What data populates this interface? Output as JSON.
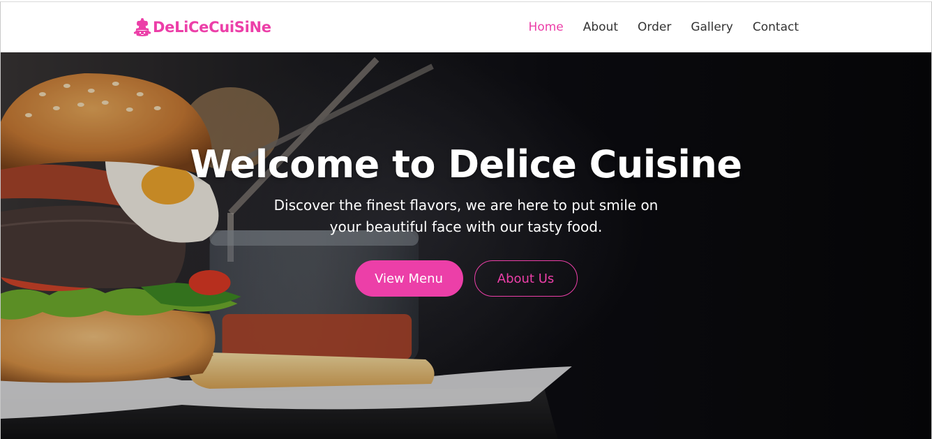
{
  "brand": {
    "name": "DeLiCeCuiSiNe",
    "icon": "chef-hat-logo-icon",
    "color": "#ec3fa8"
  },
  "nav": {
    "items": [
      {
        "label": "Home",
        "active": true
      },
      {
        "label": "About",
        "active": false
      },
      {
        "label": "Order",
        "active": false
      },
      {
        "label": "Gallery",
        "active": false
      },
      {
        "label": "Contact",
        "active": false
      }
    ],
    "active_color": "#ec3fa8",
    "text_color": "#333333"
  },
  "hero": {
    "title": "Welcome to Delice Cuisine",
    "subtitle": "Discover the finest flavors, we are here to put smile on your beautiful face with our tasty food.",
    "primary_button": "View Menu",
    "secondary_button": "About Us",
    "background_image": "burger-with-fries-and-sauce-jar"
  }
}
